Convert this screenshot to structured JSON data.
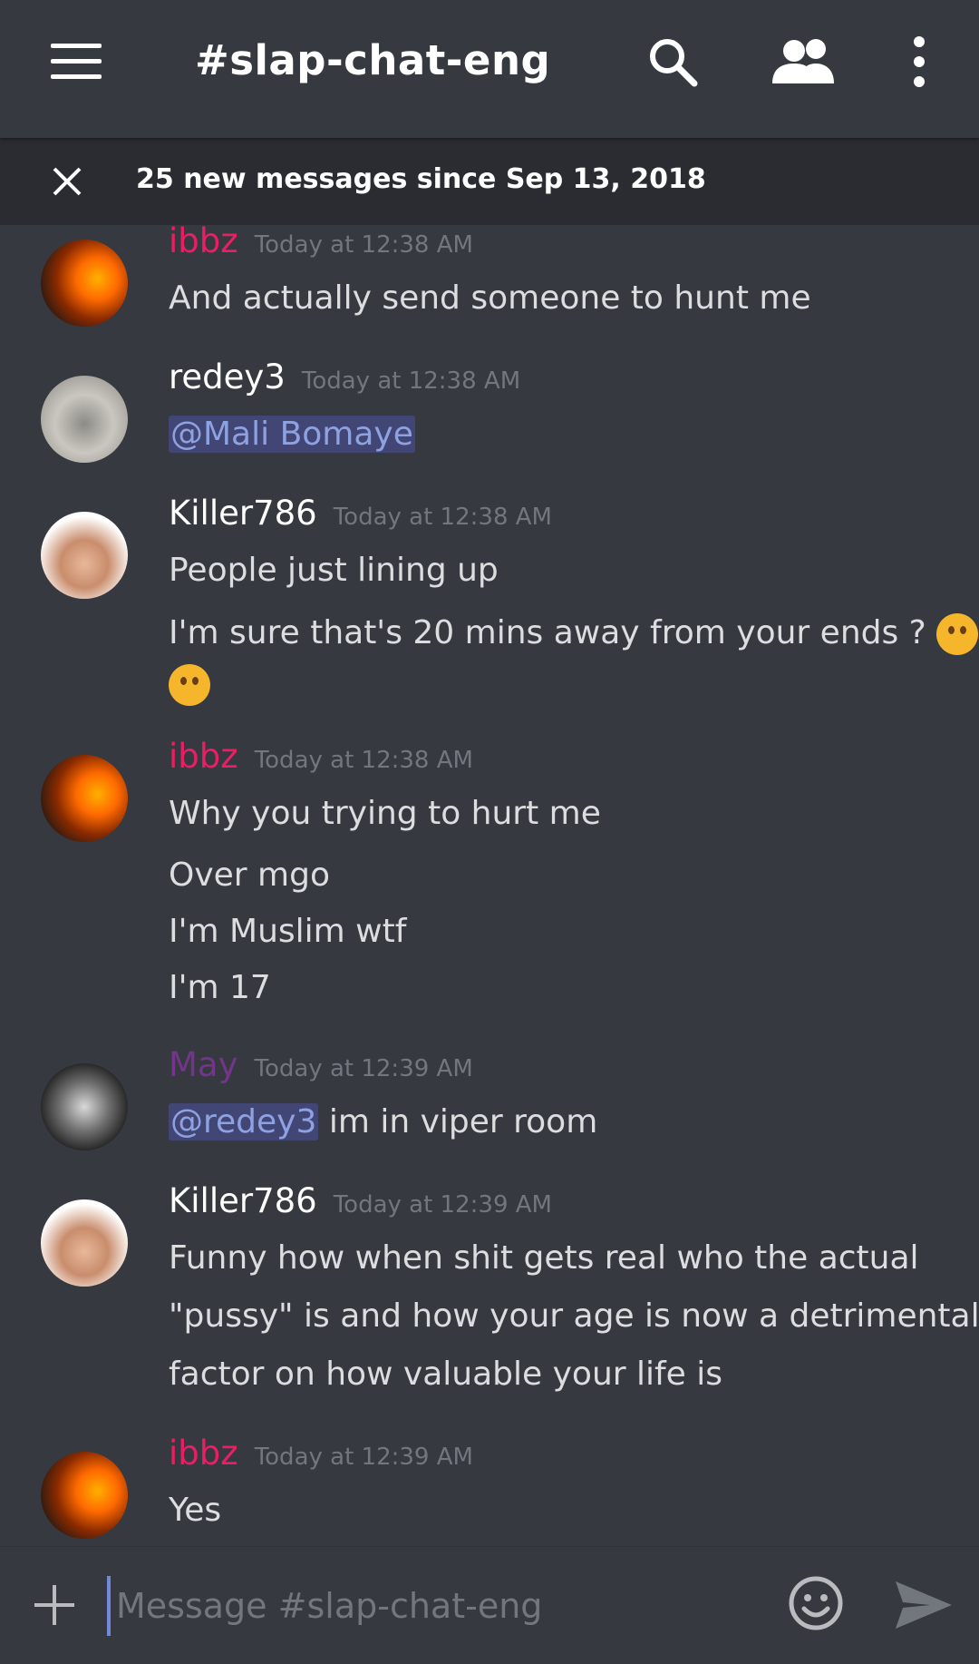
{
  "header": {
    "channel": "#slap-chat-eng",
    "icons": [
      "menu-icon",
      "search-icon",
      "members-icon",
      "more-vertical-icon"
    ]
  },
  "banner": {
    "text": "25 new messages since Sep 13, 2018",
    "icon": "close-icon"
  },
  "colors": {
    "background": "#36393f",
    "banner": "#2a2c31",
    "ibbz": "#e91e63",
    "may": "#71368a",
    "default_name": "#ffffff",
    "timestamp": "#72767d",
    "mention": "#8ea1e1"
  },
  "messages": [
    {
      "author": "ibbz",
      "time": "Today at 12:38 AM",
      "lines": [
        "And actually send someone to hunt me"
      ]
    },
    {
      "author": "redey3",
      "time": "Today at 12:38 AM",
      "lines": [
        "@Mali Bomaye"
      ]
    },
    {
      "author": "Killer786",
      "time": "Today at 12:38 AM",
      "lines": [
        "People just lining up",
        "I'm sure that's 20 mins away from your ends ?"
      ],
      "emoji": "thinking-face"
    },
    {
      "author": "ibbz",
      "time": "Today at 12:38 AM",
      "lines": [
        "Why you trying to hurt me",
        "Over mgo",
        "I'm Muslim wtf",
        "I'm 17"
      ]
    },
    {
      "author": "May",
      "time": "Today at 12:39 AM",
      "mention": "@redey3",
      "lines": [
        " im in viper room"
      ]
    },
    {
      "author": "Killer786",
      "time": "Today at 12:39 AM",
      "lines": [
        "Funny how when shit gets real who the actual",
        "\"pussy\" is and how your age is now a detrimental",
        "factor on how valuable your life is"
      ]
    },
    {
      "author": "ibbz",
      "time": "Today at 12:39 AM",
      "lines": [
        "Yes"
      ]
    }
  ],
  "composer": {
    "placeholder": "Message #slap-chat-eng",
    "icons": [
      "plus-icon",
      "emoji-icon",
      "send-icon"
    ]
  }
}
